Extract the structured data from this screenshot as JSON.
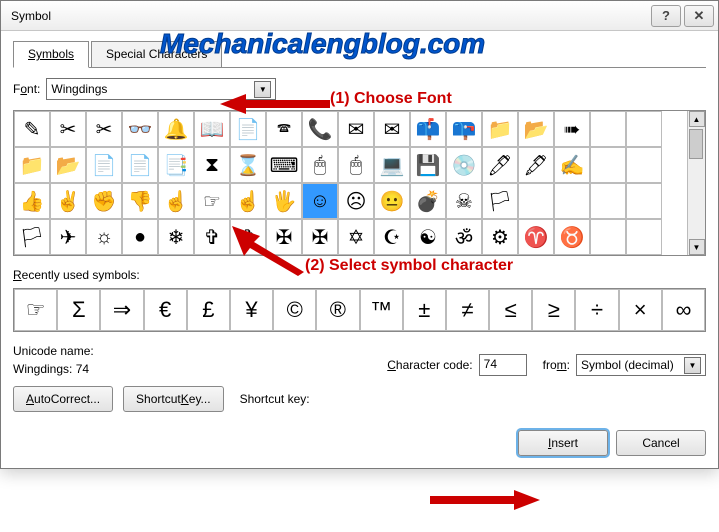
{
  "title": "Symbol",
  "help_btn": "?",
  "close_btn": "✕",
  "tabs": {
    "symbols": "Symbols",
    "special": "Special Characters"
  },
  "font_label_pre": "F",
  "font_label_u": "o",
  "font_label_post": "nt:",
  "font_value": "Wingdings",
  "grid": [
    "✎",
    "✂",
    "✂",
    "👓",
    "🔔",
    "📖",
    "📄",
    "🕿",
    "📞",
    "✉",
    "✉",
    "📫",
    "📪",
    "📁",
    "📂",
    "➠",
    "",
    "",
    "📁",
    "📂",
    "📄",
    "📄",
    "📑",
    "⧗",
    "⌛",
    "⌨",
    "🖱",
    "🖱",
    "💻",
    "💾",
    "💿",
    "🖊",
    "🖋",
    "✍",
    "",
    "",
    "👍",
    "✌",
    "✊",
    "👎",
    "☝",
    "☞",
    "☝",
    "🖐",
    "☺",
    "☹",
    "😐",
    "💣",
    "☠",
    "🏳",
    "",
    "",
    "",
    "",
    "🏳",
    "✈",
    "☼",
    "●",
    "❄",
    "✞",
    "✞",
    "✠",
    "✠",
    "✡",
    "☪",
    "☯",
    "ॐ",
    "⚙",
    "♈",
    "♉",
    "",
    ""
  ],
  "selected_index": 44,
  "recent_label_u": "R",
  "recent_label_rest": "ecently used symbols:",
  "recent": [
    "☞",
    "Σ",
    "⇒",
    "€",
    "£",
    "¥",
    "©",
    "®",
    "™",
    "±",
    "≠",
    "≤",
    "≥",
    "÷",
    "×",
    "∞"
  ],
  "unicode_name_label": "Unicode name:",
  "unicode_name_value": "Wingdings: 74",
  "char_code_label_u": "C",
  "char_code_label_rest": "haracter code:",
  "char_code_value": "74",
  "from_label_u": "m",
  "from_label_pre": "fro",
  "from_label_post": ":",
  "from_value": "Symbol (decimal)",
  "autocorrect_btn_u": "A",
  "autocorrect_btn_rest": "utoCorrect...",
  "shortcut_btn_u": "K",
  "shortcut_btn_pre": "Shortcut ",
  "shortcut_btn_post": "ey...",
  "shortcut_key_label": "Shortcut key:",
  "insert_btn_u": "I",
  "insert_btn_rest": "nsert",
  "cancel_btn": "Cancel",
  "watermark": "Mechanicalengblog.com",
  "anno1": "(1) Choose Font",
  "anno2": "(2) Select symbol character"
}
